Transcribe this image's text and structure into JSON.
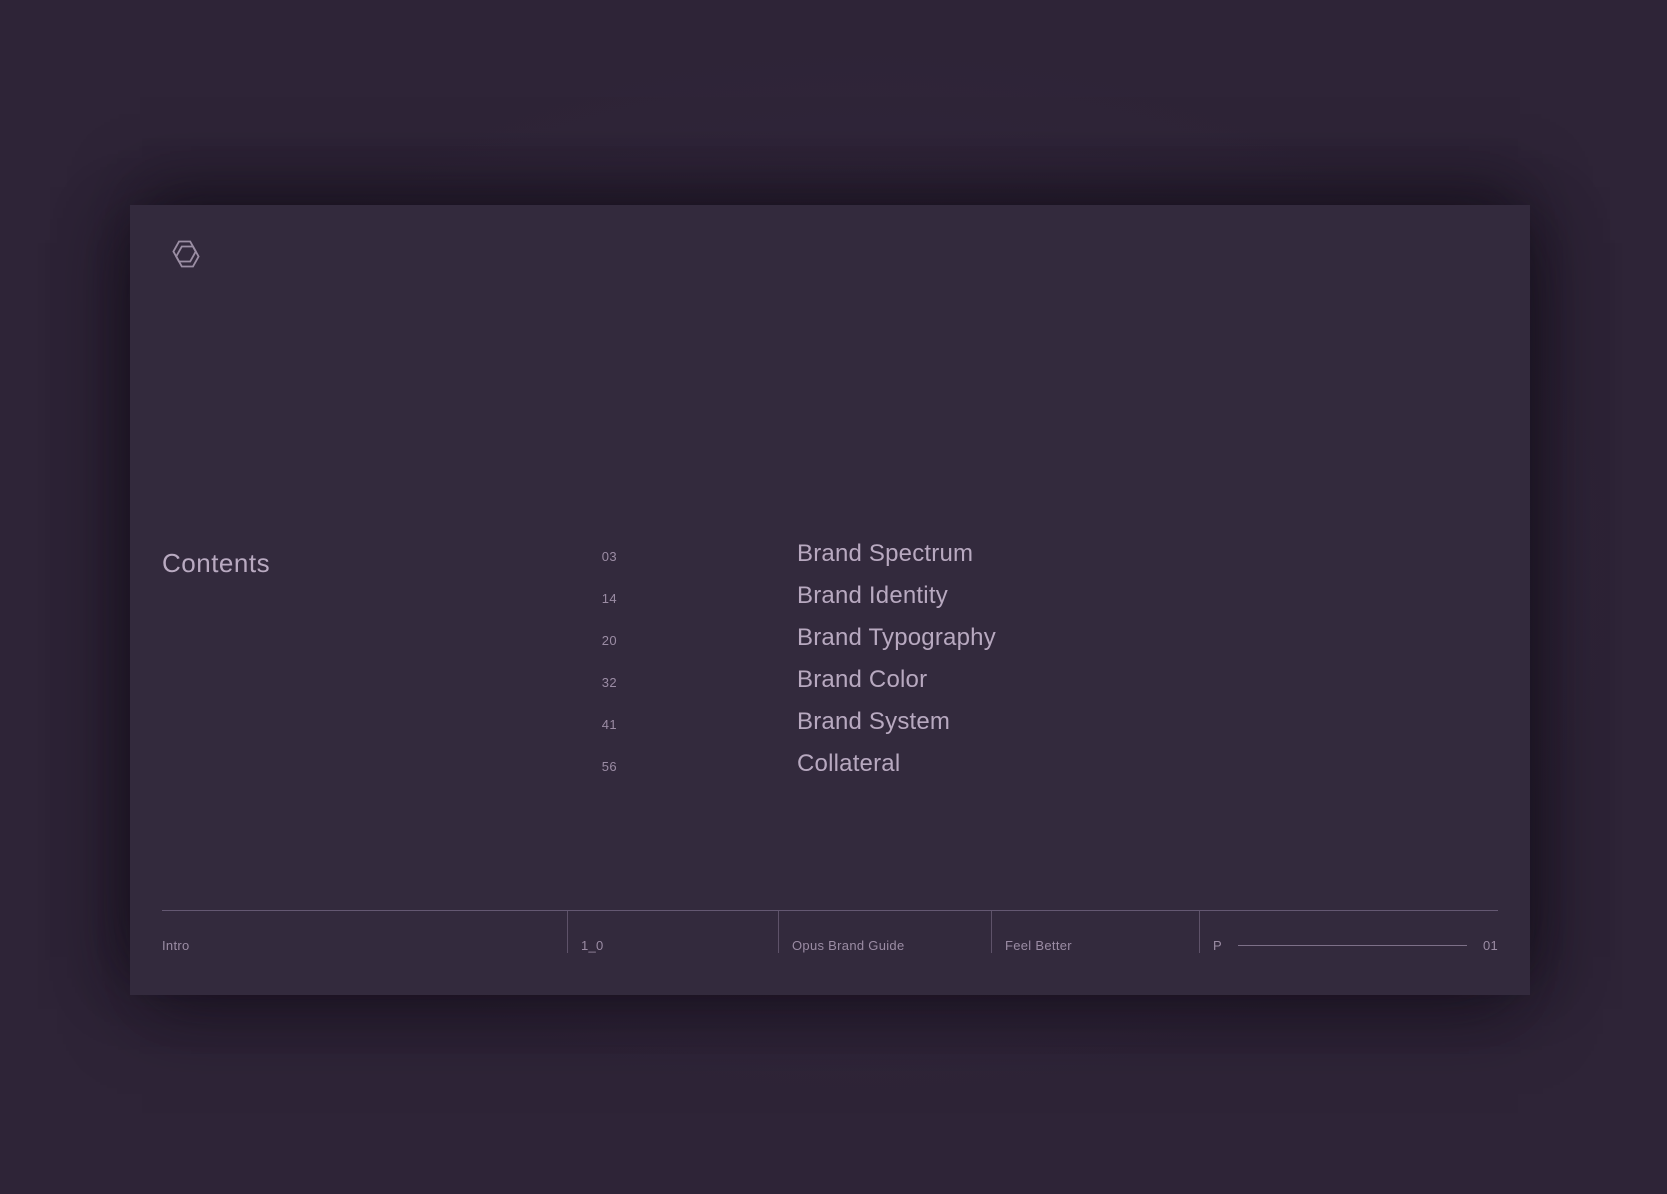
{
  "theme": {
    "backdrop_color": "#2e2437",
    "slide_color": "#332a3d",
    "text_primary": "#b8a9c0",
    "text_muted": "#9b8ca4",
    "rule_color": "#645872"
  },
  "slide": {
    "logo": {
      "name": "opus-hexagon-logo",
      "stroke_color": "#9b8ea4"
    },
    "contents": {
      "heading": "Contents",
      "items": [
        {
          "page": "03",
          "title": "Brand Spectrum"
        },
        {
          "page": "14",
          "title": "Brand Identity"
        },
        {
          "page": "20",
          "title": "Brand Typography"
        },
        {
          "page": "32",
          "title": "Brand Color"
        },
        {
          "page": "41",
          "title": "Brand System"
        },
        {
          "page": "56",
          "title": "Collateral"
        }
      ]
    },
    "footer": {
      "section": "Intro",
      "version": "1_0",
      "document": "Opus Brand Guide",
      "tagline": "Feel Better",
      "page_prefix": "P",
      "page_number": "01"
    }
  }
}
